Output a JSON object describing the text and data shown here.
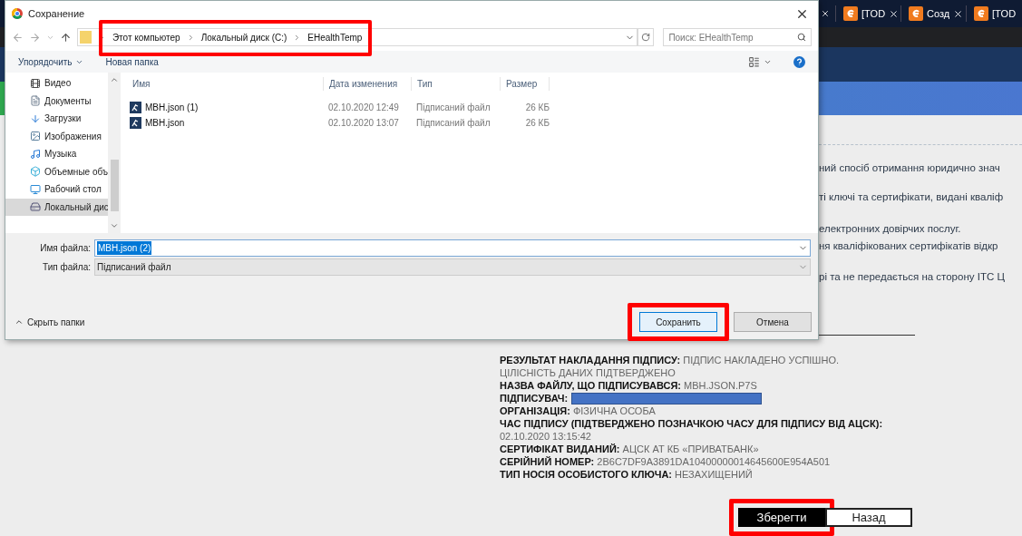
{
  "browser": {
    "tabs": [
      {
        "label": "[TOD"
      },
      {
        "label": "Созд"
      },
      {
        "label": "[TOD"
      }
    ]
  },
  "page": {
    "lines": [
      "ний спосіб отримання юридично знач",
      "ті ключі та сертифікати, видані кваліф",
      "електронних довірчих послуг.",
      "ня кваліфікованих сертифікатів відкр",
      "рі та не передається на сторону ІТС Ц"
    ],
    "signature": [
      {
        "label": "РЕЗУЛЬТАТ НАКЛАДАННЯ ПІДПИСУ:",
        "value": "ПІДПИС НАКЛАДЕНО УСПІШНО. ЦІЛІСНІСТЬ ДАНИХ ПІДТВЕРДЖЕНО"
      },
      {
        "label": "НАЗВА ФАЙЛУ, ЩО ПІДПИСУВАВСЯ:",
        "value": "MBH.JSON.P7S"
      },
      {
        "label": "ПІДПИСУВАЧ:",
        "redacted": true
      },
      {
        "label": "ОРГАНІЗАЦІЯ:",
        "value": "ФІЗИЧНА ОСОБА"
      },
      {
        "label": "ЧАС ПІДПИСУ (ПІДТВЕРДЖЕНО ПОЗНАЧКОЮ ЧАСУ ДЛЯ ПІДПИСУ ВІД АЦСК):",
        "value": "02.10.2020 13:15:42"
      },
      {
        "label": "СЕРТИФІКАТ ВИДАНИЙ:",
        "value": "АЦСК АТ КБ «ПРИВАТБАНК»"
      },
      {
        "label": "СЕРІЙНИЙ НОМЕР:",
        "value": "2B6C7DF9A3891DA10400000014645600E954A501"
      },
      {
        "label": "ТИП НОСІЯ ОСОБИСТОГО КЛЮЧА:",
        "value": "НЕЗАХИЩЕНИЙ"
      }
    ],
    "buttons": [
      {
        "label": "Зберегти",
        "kind": "primary",
        "highlighted": true
      },
      {
        "label": "Назад",
        "kind": "secondary",
        "highlighted": false
      }
    ]
  },
  "dialog": {
    "title": "Сохранение",
    "breadcrumbs": [
      "Этот компьютер",
      "Локальный диск (C:)",
      "EHealthTemp"
    ],
    "address_highlighted": true,
    "search": {
      "placeholder": "Поиск: EHealthTemp"
    },
    "toolbar": {
      "organize": "Упорядочить",
      "new_folder": "Новая папка"
    },
    "nav_items": [
      {
        "label": "Видео",
        "kind": "video",
        "selected": false
      },
      {
        "label": "Документы",
        "kind": "documents",
        "selected": false
      },
      {
        "label": "Загрузки",
        "kind": "downloads",
        "selected": false
      },
      {
        "label": "Изображения",
        "kind": "pictures",
        "selected": false
      },
      {
        "label": "Музыка",
        "kind": "music",
        "selected": false
      },
      {
        "label": "Объемные объ",
        "kind": "objects",
        "selected": false
      },
      {
        "label": "Рабочий стол",
        "kind": "desktop",
        "selected": false
      },
      {
        "label": "Локальный дис",
        "kind": "drive",
        "selected": true
      }
    ],
    "table": {
      "columns": [
        "Имя",
        "Дата изменения",
        "Тип",
        "Размер"
      ],
      "rows": [
        {
          "cells": [
            "MBH.json (1)",
            "02.10.2020 12:49",
            "Підписаний файл",
            "26 КБ"
          ]
        },
        {
          "cells": [
            "MBH.json",
            "02.10.2020 13:07",
            "Підписаний файл",
            "26 КБ"
          ]
        }
      ]
    },
    "file_name": {
      "label": "Имя файла:",
      "value": "MBH.json (2)"
    },
    "file_type": {
      "label": "Тип файла:",
      "value": "Підписаний файл"
    },
    "hide_folders": "Скрыть папки",
    "buttons": [
      {
        "label": "Сохранить",
        "kind": "default",
        "highlighted": true
      },
      {
        "label": "Отмена",
        "kind": "normal",
        "highlighted": false
      }
    ]
  }
}
